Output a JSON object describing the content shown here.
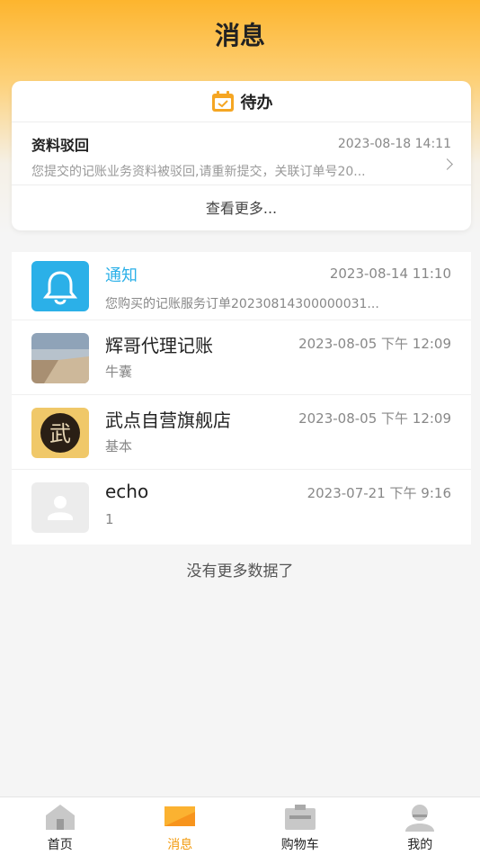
{
  "header": {
    "title": "消息"
  },
  "todo": {
    "title": "待办",
    "item": {
      "title": "资料驳回",
      "time": "2023-08-18 14:11",
      "desc": "您提交的记账业务资料被驳回,请重新提交，关联订单号20..."
    },
    "more": "查看更多..."
  },
  "messages": [
    {
      "title": "通知",
      "time": "2023-08-14 11:10",
      "sub": "您购买的记账服务订单20230814300000031...",
      "icon": "bell-icon"
    },
    {
      "title": "辉哥代理记账",
      "time": "2023-08-05 下午 12:09",
      "sub": "牛囊",
      "icon": "pier-photo-avatar"
    },
    {
      "title": "武点自营旗舰店",
      "time": "2023-08-05 下午 12:09",
      "sub": "基本",
      "icon": "wu-logo-avatar",
      "logo_text": "武"
    },
    {
      "title": "echo",
      "time": "2023-07-21 下午 9:16",
      "sub": "1",
      "icon": "default-user-avatar"
    }
  ],
  "footer_note": "没有更多数据了",
  "tabbar": [
    {
      "label": "首页",
      "icon": "home-icon",
      "active": false
    },
    {
      "label": "消息",
      "icon": "message-icon",
      "active": true
    },
    {
      "label": "购物车",
      "icon": "cart-icon",
      "active": false
    },
    {
      "label": "我的",
      "icon": "profile-icon",
      "active": false
    }
  ],
  "colors": {
    "accent": "#f29a0e",
    "notice": "#2bb0e8",
    "header": "#fdb52e"
  }
}
